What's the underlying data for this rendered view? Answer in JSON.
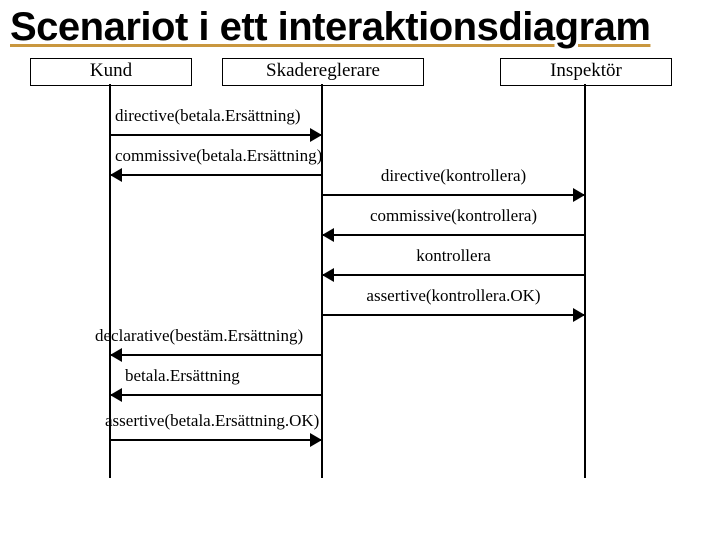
{
  "title": "Scenariot i ett interaktionsdiagram",
  "actors": {
    "kund": "Kund",
    "skadereglerare": "Skadereglerare",
    "inspektor": "Inspektör"
  },
  "messages": {
    "m1": "directive(betala.Ersättning)",
    "m2": "commissive(betala.Ersättning)",
    "m3": "directive(kontrollera)",
    "m4": "commissive(kontrollera)",
    "m5": "kontrollera",
    "m6": "assertive(kontrollera.OK)",
    "m7": "declarative(bestäm.Ersättning)",
    "m8": "betala.Ersättning",
    "m9": "assertive(betala.Ersättning.OK)"
  }
}
